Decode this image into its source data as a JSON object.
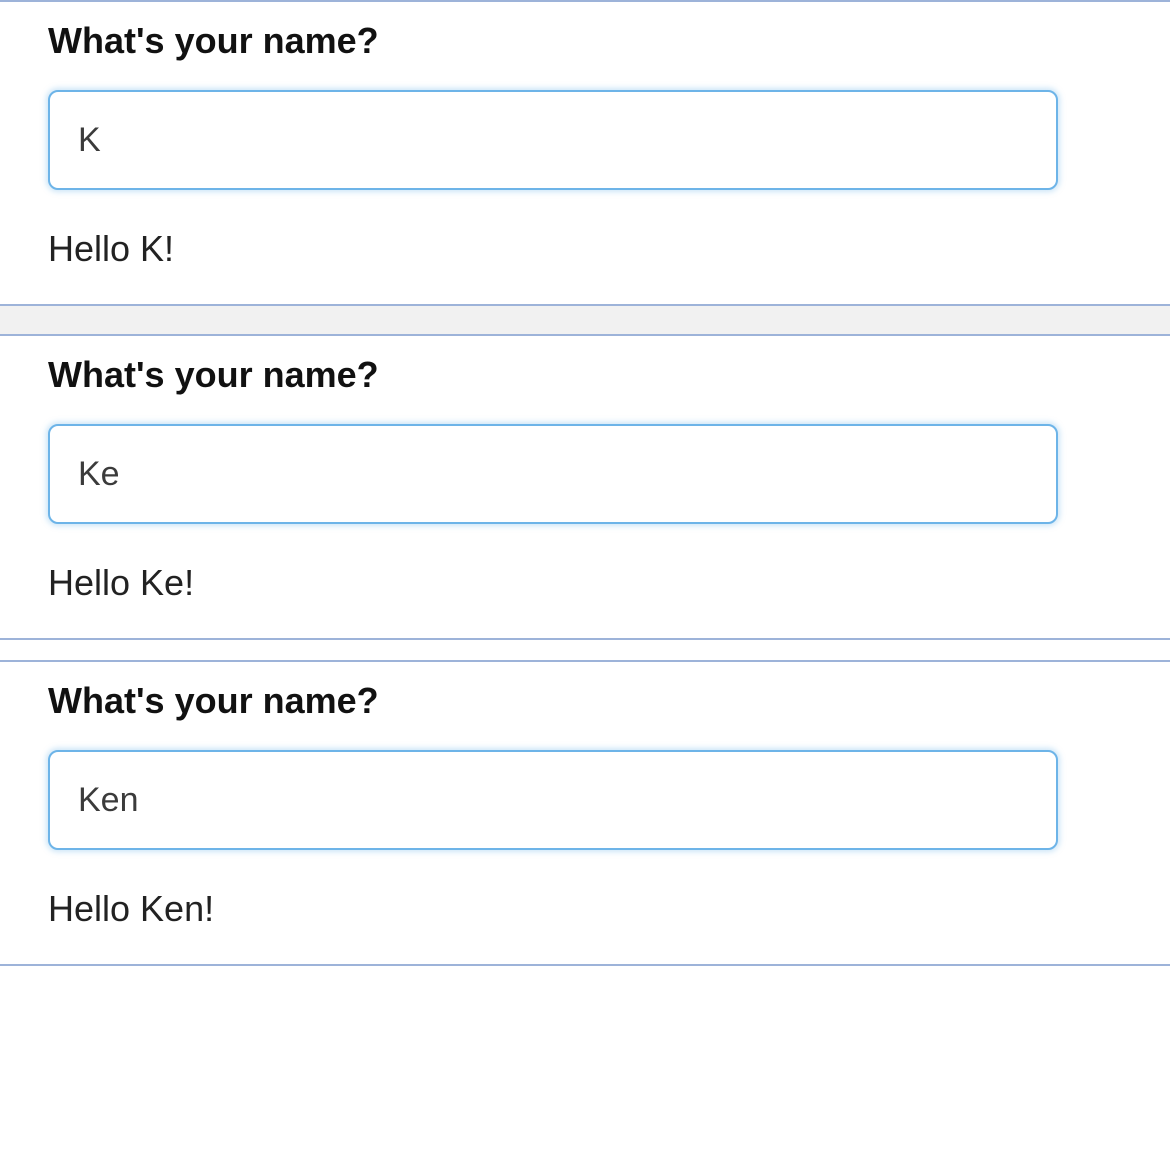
{
  "panels": [
    {
      "prompt": "What's your name?",
      "input_value": "K",
      "greeting": "Hello K!"
    },
    {
      "prompt": "What's your name?",
      "input_value": "Ke",
      "greeting": "Hello Ke!"
    },
    {
      "prompt": "What's your name?",
      "input_value": "Ken",
      "greeting": "Hello Ken!"
    }
  ]
}
